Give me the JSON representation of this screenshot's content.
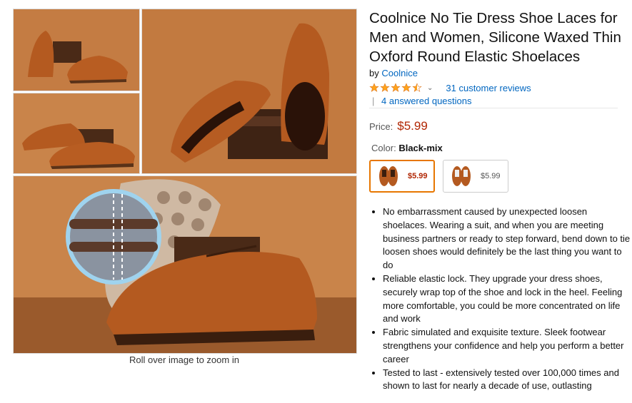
{
  "gallery": {
    "zoom_hint": "Roll over image to zoom in"
  },
  "product": {
    "title": "Coolnice No Tie Dress Shoe Laces for Men and Women, Silicone Waxed Thin Oxford Round Elastic Shoelaces",
    "by_prefix": "by",
    "brand": "Coolnice",
    "rating": 4.5,
    "reviews_text": "31 customer reviews",
    "separator": "|",
    "questions_text": "4 answered questions",
    "price_label": "Price:",
    "price": "$5.99",
    "color_label": "Color:",
    "color_value": "Black-mix",
    "variants": [
      {
        "price": "$5.99",
        "selected": true
      },
      {
        "price": "$5.99",
        "selected": false
      }
    ],
    "bullets": [
      "No embarrassment caused by unexpected loosen shoelaces. Wearing a suit, and when you are meeting business partners or ready to step forward, bend down to tie loosen shoes would definitely be the last thing you want to do",
      "Reliable elastic lock. They upgrade your dress shoes, securely wrap top of the shoe and lock in the heel. Feeling more comfortable, you could be more concentrated on life and work",
      "Fabric simulated and exquisite texture. Sleek footwear strengthens your confidence and help you perform a better career",
      "Tested to last - extensively tested over 100,000 times and shown to last for nearly a decade of use, outlasting"
    ]
  },
  "colors": {
    "link": "#0066c0",
    "price": "#b12704",
    "star": "#ffa41c",
    "selected_border": "#e77600"
  }
}
